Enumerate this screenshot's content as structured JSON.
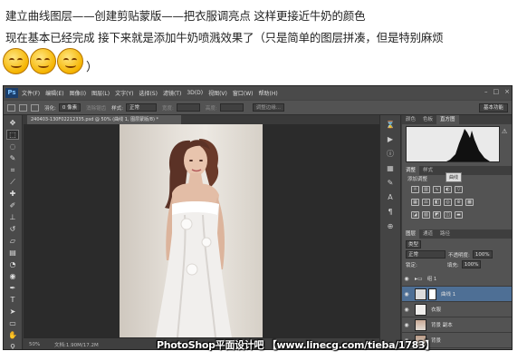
{
  "tutorial": {
    "line1": "建立曲线图层——创建剪贴蒙版——把衣服调亮点 这样更接近牛奶的颜色",
    "line2": "现在基本已经完成 接下来就是添加牛奶喷溅效果了（只是简单的图层拼凑，但是特别麻烦",
    "close_paren": "）"
  },
  "app": {
    "logo": "Ps",
    "menu": [
      "文件(F)",
      "编辑(E)",
      "图像(I)",
      "图层(L)",
      "文字(Y)",
      "选择(S)",
      "滤镜(T)",
      "3D(D)",
      "视图(V)",
      "窗口(W)",
      "帮助(H)"
    ],
    "window_buttons": [
      "–",
      "□",
      "×"
    ]
  },
  "options_bar": {
    "feather_label": "羽化:",
    "feather_value": "0 像素",
    "antialias_label": "消除锯齿",
    "style_label": "样式:",
    "style_value": "正常",
    "width_label": "宽度:",
    "height_label": "高度:",
    "refine_edge": "调整边缘...",
    "workspace": "基本功能"
  },
  "document": {
    "tab_title": "240403-130F02212335.psd @ 50% (曲线 1, 图层蒙版/8) *",
    "zoom": "50%",
    "doc_size": "文档:1.90M/17.2M"
  },
  "panels": {
    "top_tabs": [
      "颜色",
      "色板",
      "直方图"
    ],
    "adjust_tabs": [
      "调整",
      "样式"
    ],
    "adjust_title": "添加调整",
    "tooltip": "曲线",
    "layers_tabs": [
      "图层",
      "通道",
      "路径"
    ],
    "filter_label": "类型",
    "blend_mode": "正常",
    "opacity_label": "不透明度:",
    "opacity_value": "100%",
    "lock_label": "锁定:",
    "fill_label": "填充:",
    "fill_value": "100%",
    "layers": [
      {
        "name": "组 1",
        "selected": false
      },
      {
        "name": "曲线 1",
        "selected": true
      },
      {
        "name": "衣服",
        "selected": false
      },
      {
        "name": "背景 副本",
        "selected": false
      },
      {
        "name": "背景",
        "selected": false
      }
    ]
  },
  "watermark": "PhotoShop平面设计吧 【www.linecg.com/tieba/1783】",
  "colors": {
    "ps_dark": "#3b3b3b",
    "panel": "#535353",
    "selection": "#4e6f95"
  }
}
